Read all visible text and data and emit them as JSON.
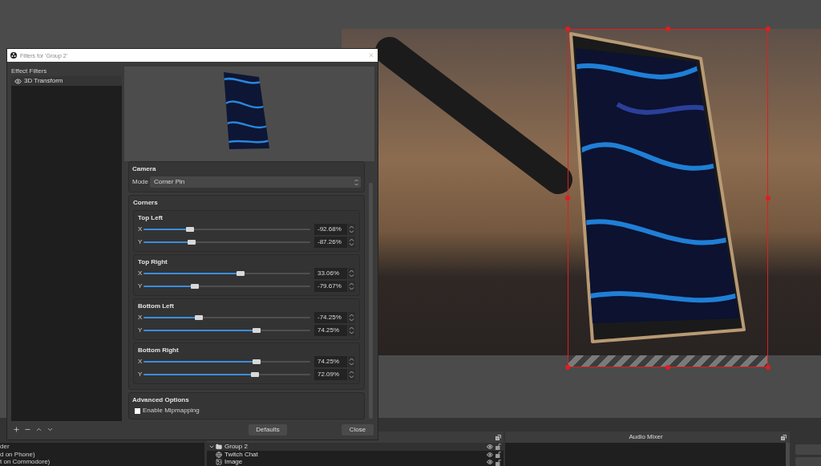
{
  "dialog": {
    "title": "Filters for 'Group 2'",
    "filters_label": "Effect Filters",
    "filters": [
      {
        "label": "3D Transform",
        "selected": true,
        "visible": true
      }
    ],
    "camera": {
      "title": "Camera",
      "mode_label": "Mode",
      "mode_value": "Corner Pin"
    },
    "corners": {
      "title": "Corners",
      "groups": [
        {
          "title": "Top Left",
          "axes": [
            {
              "label": "X",
              "level": 0.28,
              "value": "-92.68%"
            },
            {
              "label": "Y",
              "level": 0.29,
              "value": "-87.26%"
            }
          ]
        },
        {
          "title": "Top Right",
          "axes": [
            {
              "label": "X",
              "level": 0.58,
              "value": "33.06%"
            },
            {
              "label": "Y",
              "level": 0.31,
              "value": "-79.67%"
            }
          ]
        },
        {
          "title": "Bottom Left",
          "axes": [
            {
              "label": "X",
              "level": 0.33,
              "value": "-74.25%"
            },
            {
              "label": "Y",
              "level": 0.68,
              "value": "74.25%"
            }
          ]
        },
        {
          "title": "Bottom Right",
          "axes": [
            {
              "label": "X",
              "level": 0.68,
              "value": "74.25%"
            },
            {
              "label": "Y",
              "level": 0.67,
              "value": "72.09%"
            }
          ]
        }
      ]
    },
    "advanced": {
      "title": "Advanced Options",
      "options": [
        {
          "label": "Enable Mipmapping",
          "checked": false
        }
      ]
    },
    "buttons": [
      "Defaults",
      "Close"
    ]
  },
  "scenes": {
    "items": [
      {
        "label": "der",
        "selected": false
      },
      {
        "label": "d on Phone)",
        "selected": false
      },
      {
        "label": "t on Commodore)",
        "selected": false
      }
    ]
  },
  "sources": {
    "items": [
      {
        "label": "Group 2",
        "kind": "group",
        "expanded": true,
        "selected": true,
        "visible": true,
        "children": [
          {
            "label": "Twitch Chat",
            "kind": "browser",
            "selected": false,
            "visible": true
          },
          {
            "label": "Image",
            "kind": "image",
            "selected": false,
            "visible": true
          }
        ]
      }
    ]
  },
  "audio_mixer": {
    "title": "Audio Mixer"
  }
}
